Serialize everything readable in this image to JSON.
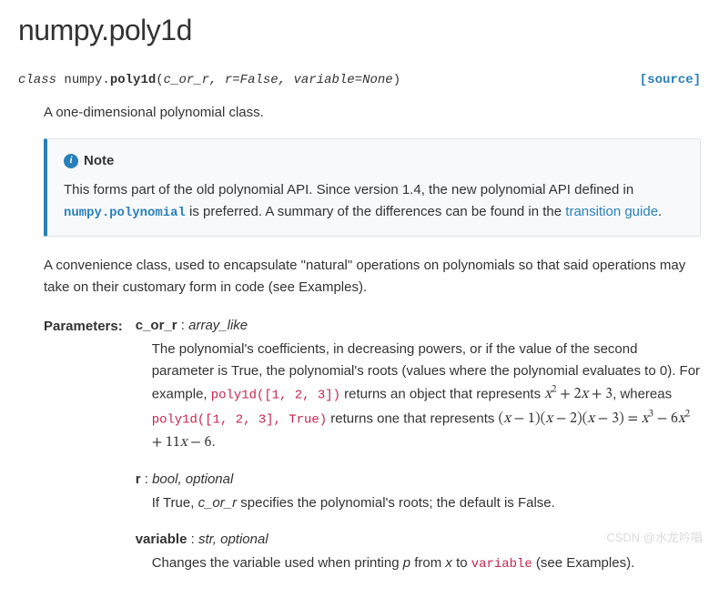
{
  "page_title": "numpy.poly1d",
  "signature": {
    "kw": "class",
    "module": "numpy.",
    "name": "poly1d",
    "params": "c_or_r, r=False, variable=None"
  },
  "source_link": "[source]",
  "summary": "A one-dimensional polynomial class.",
  "note": {
    "title": "Note",
    "text_pre": "This forms part of the old polynomial API. Since version 1.4, the new polynomial API defined in ",
    "link1": "numpy.polynomial",
    "text_mid": " is preferred. A summary of the differences can be found in the ",
    "link2": "transition guide",
    "text_post": "."
  },
  "description": "A convenience class, used to encapsulate \"natural\" operations on polynomials so that said operations may take on their customary form in code (see Examples).",
  "params_label": "Parameters:",
  "params": [
    {
      "name": "c_or_r",
      "type": "array_like",
      "desc_pre": "The polynomial's coefficients, in decreasing powers, or if the value of the second parameter is True, the polynomial's roots (values where the polynomial evaluates to 0). For example, ",
      "code1": "poly1d([1, 2, 3])",
      "desc_mid1": " returns an object that represents ",
      "math1": "x² + 2x + 3",
      "desc_mid2": ", whereas ",
      "code2": "poly1d([1, 2, 3], True)",
      "desc_mid3": " returns one that represents ",
      "math2": "(x − 1)(x − 2)(x − 3) = x³ − 6x² + 11x − 6",
      "desc_post": "."
    },
    {
      "name": "r",
      "type": "bool, optional",
      "desc_pre": "If True, ",
      "em": "c_or_r",
      "desc_post": " specifies the polynomial's roots; the default is False."
    },
    {
      "name": "variable",
      "type": "str, optional",
      "desc_pre": "Changes the variable used when printing ",
      "em1": "p",
      "desc_mid1": " from ",
      "em2": "x",
      "desc_mid2": " to ",
      "code1": "variable",
      "desc_post": " (see Examples)."
    }
  ],
  "watermark": "CSDN @水龙吟唱"
}
